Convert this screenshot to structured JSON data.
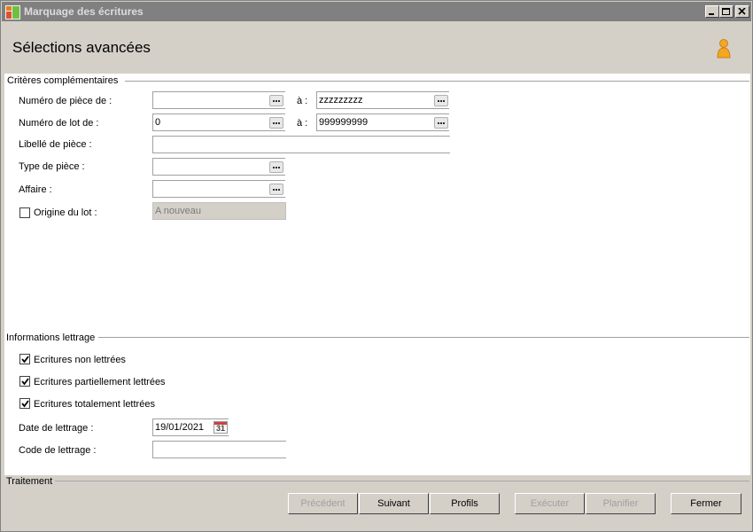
{
  "window": {
    "title": "Marquage des écritures"
  },
  "header": {
    "title": "Sélections avancées"
  },
  "criteria": {
    "group_title": "Critères complémentaires",
    "a_label": "à :",
    "piece_num_label": "Numéro de pièce de :",
    "piece_num_from": "",
    "piece_num_to": "zzzzzzzzz",
    "lot_num_label": "Numéro de lot de :",
    "lot_num_from": "0",
    "lot_num_to": "999999999",
    "piece_label_label": "Libellé de pièce :",
    "piece_label_value": "",
    "piece_type_label": "Type de pièce :",
    "piece_type_value": "",
    "affaire_label": "Affaire :",
    "affaire_value": "",
    "origine_label": "Origine du lot :",
    "origine_checked": false,
    "origine_value": "A nouveau"
  },
  "lettrage": {
    "group_title": "Informations lettrage",
    "non_lettrees": "Ecritures non lettrées",
    "partiellement": "Ecritures partiellement lettrées",
    "totalement": "Ecritures totalement lettrées",
    "date_label": "Date de lettrage :",
    "date_value": "19/01/2021",
    "calendar_day": "31",
    "code_label": "Code de lettrage :",
    "code_value": ""
  },
  "footer": {
    "group_title": "Traitement",
    "buttons": {
      "precedent": "Précédent",
      "suivant": "Suivant",
      "profils": "Profils",
      "executer": "Exécuter",
      "planifier": "Planifier",
      "fermer": "Fermer"
    }
  }
}
